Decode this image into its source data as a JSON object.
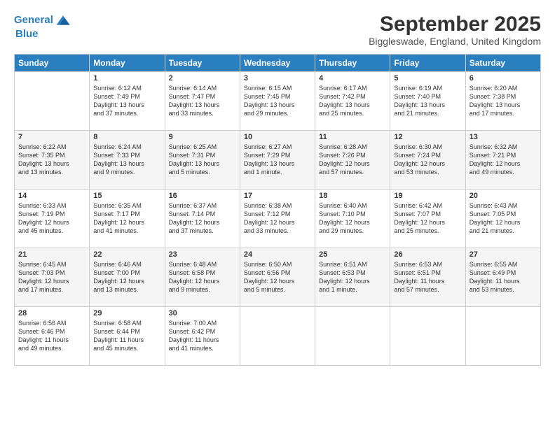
{
  "header": {
    "logo_line1": "General",
    "logo_line2": "Blue",
    "month": "September 2025",
    "location": "Biggleswade, England, United Kingdom"
  },
  "days_of_week": [
    "Sunday",
    "Monday",
    "Tuesday",
    "Wednesday",
    "Thursday",
    "Friday",
    "Saturday"
  ],
  "weeks": [
    [
      {
        "day": "",
        "text": ""
      },
      {
        "day": "1",
        "text": "Sunrise: 6:12 AM\nSunset: 7:49 PM\nDaylight: 13 hours\nand 37 minutes."
      },
      {
        "day": "2",
        "text": "Sunrise: 6:14 AM\nSunset: 7:47 PM\nDaylight: 13 hours\nand 33 minutes."
      },
      {
        "day": "3",
        "text": "Sunrise: 6:15 AM\nSunset: 7:45 PM\nDaylight: 13 hours\nand 29 minutes."
      },
      {
        "day": "4",
        "text": "Sunrise: 6:17 AM\nSunset: 7:42 PM\nDaylight: 13 hours\nand 25 minutes."
      },
      {
        "day": "5",
        "text": "Sunrise: 6:19 AM\nSunset: 7:40 PM\nDaylight: 13 hours\nand 21 minutes."
      },
      {
        "day": "6",
        "text": "Sunrise: 6:20 AM\nSunset: 7:38 PM\nDaylight: 13 hours\nand 17 minutes."
      }
    ],
    [
      {
        "day": "7",
        "text": "Sunrise: 6:22 AM\nSunset: 7:35 PM\nDaylight: 13 hours\nand 13 minutes."
      },
      {
        "day": "8",
        "text": "Sunrise: 6:24 AM\nSunset: 7:33 PM\nDaylight: 13 hours\nand 9 minutes."
      },
      {
        "day": "9",
        "text": "Sunrise: 6:25 AM\nSunset: 7:31 PM\nDaylight: 13 hours\nand 5 minutes."
      },
      {
        "day": "10",
        "text": "Sunrise: 6:27 AM\nSunset: 7:29 PM\nDaylight: 13 hours\nand 1 minute."
      },
      {
        "day": "11",
        "text": "Sunrise: 6:28 AM\nSunset: 7:26 PM\nDaylight: 12 hours\nand 57 minutes."
      },
      {
        "day": "12",
        "text": "Sunrise: 6:30 AM\nSunset: 7:24 PM\nDaylight: 12 hours\nand 53 minutes."
      },
      {
        "day": "13",
        "text": "Sunrise: 6:32 AM\nSunset: 7:21 PM\nDaylight: 12 hours\nand 49 minutes."
      }
    ],
    [
      {
        "day": "14",
        "text": "Sunrise: 6:33 AM\nSunset: 7:19 PM\nDaylight: 12 hours\nand 45 minutes."
      },
      {
        "day": "15",
        "text": "Sunrise: 6:35 AM\nSunset: 7:17 PM\nDaylight: 12 hours\nand 41 minutes."
      },
      {
        "day": "16",
        "text": "Sunrise: 6:37 AM\nSunset: 7:14 PM\nDaylight: 12 hours\nand 37 minutes."
      },
      {
        "day": "17",
        "text": "Sunrise: 6:38 AM\nSunset: 7:12 PM\nDaylight: 12 hours\nand 33 minutes."
      },
      {
        "day": "18",
        "text": "Sunrise: 6:40 AM\nSunset: 7:10 PM\nDaylight: 12 hours\nand 29 minutes."
      },
      {
        "day": "19",
        "text": "Sunrise: 6:42 AM\nSunset: 7:07 PM\nDaylight: 12 hours\nand 25 minutes."
      },
      {
        "day": "20",
        "text": "Sunrise: 6:43 AM\nSunset: 7:05 PM\nDaylight: 12 hours\nand 21 minutes."
      }
    ],
    [
      {
        "day": "21",
        "text": "Sunrise: 6:45 AM\nSunset: 7:03 PM\nDaylight: 12 hours\nand 17 minutes."
      },
      {
        "day": "22",
        "text": "Sunrise: 6:46 AM\nSunset: 7:00 PM\nDaylight: 12 hours\nand 13 minutes."
      },
      {
        "day": "23",
        "text": "Sunrise: 6:48 AM\nSunset: 6:58 PM\nDaylight: 12 hours\nand 9 minutes."
      },
      {
        "day": "24",
        "text": "Sunrise: 6:50 AM\nSunset: 6:56 PM\nDaylight: 12 hours\nand 5 minutes."
      },
      {
        "day": "25",
        "text": "Sunrise: 6:51 AM\nSunset: 6:53 PM\nDaylight: 12 hours\nand 1 minute."
      },
      {
        "day": "26",
        "text": "Sunrise: 6:53 AM\nSunset: 6:51 PM\nDaylight: 11 hours\nand 57 minutes."
      },
      {
        "day": "27",
        "text": "Sunrise: 6:55 AM\nSunset: 6:49 PM\nDaylight: 11 hours\nand 53 minutes."
      }
    ],
    [
      {
        "day": "28",
        "text": "Sunrise: 6:56 AM\nSunset: 6:46 PM\nDaylight: 11 hours\nand 49 minutes."
      },
      {
        "day": "29",
        "text": "Sunrise: 6:58 AM\nSunset: 6:44 PM\nDaylight: 11 hours\nand 45 minutes."
      },
      {
        "day": "30",
        "text": "Sunrise: 7:00 AM\nSunset: 6:42 PM\nDaylight: 11 hours\nand 41 minutes."
      },
      {
        "day": "",
        "text": ""
      },
      {
        "day": "",
        "text": ""
      },
      {
        "day": "",
        "text": ""
      },
      {
        "day": "",
        "text": ""
      }
    ]
  ]
}
